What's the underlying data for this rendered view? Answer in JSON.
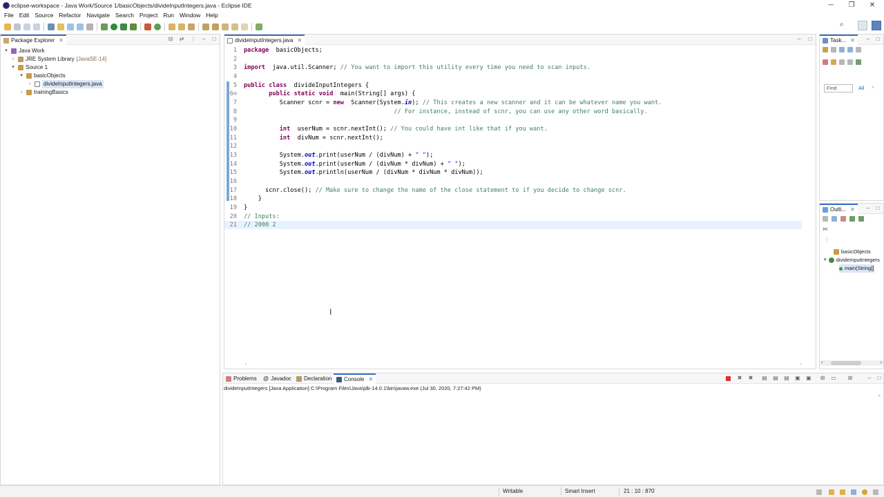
{
  "window": {
    "title": "eclipse-workspace - Java Work/Source 1/basicObjects/divideInputIntegers.java - Eclipse IDE",
    "minimize": "─",
    "restore": "❐",
    "close": "✕"
  },
  "menu": [
    "File",
    "Edit",
    "Source",
    "Refactor",
    "Navigate",
    "Search",
    "Project",
    "Run",
    "Window",
    "Help"
  ],
  "package_explorer": {
    "tab_label": "Package Explorer",
    "items": [
      {
        "label": "Java Work",
        "twisty": "▾"
      },
      {
        "label": "JRE System Library",
        "suffix": "[JavaSE-14]",
        "twisty": "›"
      },
      {
        "label": "Source 1",
        "twisty": "▾"
      },
      {
        "label": "basicObjects",
        "twisty": "▾"
      },
      {
        "label": "divideInputIntegers.java",
        "twisty": "›"
      },
      {
        "label": "trainingBasics",
        "twisty": "›"
      }
    ]
  },
  "editor": {
    "tab_label": "divideInputIntegers.java",
    "line_numbers": [
      "1",
      "2",
      "3",
      "4",
      "5",
      "6⊖",
      "7",
      "8",
      "9",
      "10",
      "11",
      "12",
      "13",
      "14",
      "15",
      "16",
      "17",
      "18",
      "19",
      "20",
      "21"
    ]
  },
  "tasks": {
    "tab_label": "Task...",
    "find_placeholder": "Find",
    "all_label": "All"
  },
  "outline": {
    "tab_label": "Outli...",
    "items": [
      "basicObjects",
      "divideInputIntegers",
      "main(String[]"
    ]
  },
  "bottom": {
    "tabs": [
      "Problems",
      "Javadoc",
      "Declaration",
      "Console"
    ],
    "console_path": "divideInputIntegers [Java Application] C:\\Program Files\\Java\\jdk-14.0.1\\bin\\javaw.exe  (Jul 30, 2020, 7:27:42 PM)"
  },
  "status": {
    "writable": "Writable",
    "insert_mode": "Smart Insert",
    "position": "21 : 10 : 870"
  },
  "colors": {
    "keyword": "#7f0055",
    "comment": "#3f7f5f",
    "string": "#2a00ff",
    "accent": "#3a70c7"
  }
}
